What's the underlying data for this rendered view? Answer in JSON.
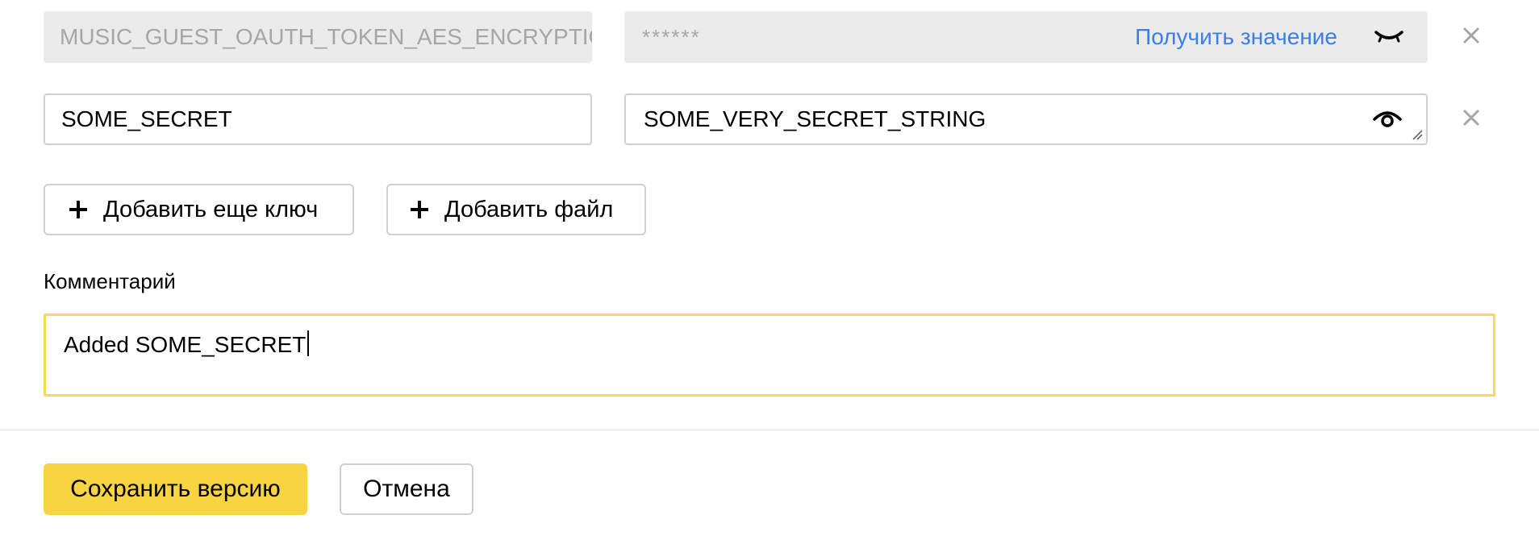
{
  "rows": [
    {
      "key": "MUSIC_GUEST_OAUTH_TOKEN_AES_ENCRYPTION",
      "value_masked": "******",
      "get_value_link": "Получить значение",
      "eye_icon": "eye-closed-icon",
      "remove_icon": "close-icon",
      "disabled": true
    },
    {
      "key": "SOME_SECRET",
      "value": "SOME_VERY_SECRET_STRING",
      "eye_icon": "eye-open-icon",
      "remove_icon": "close-icon",
      "disabled": false
    }
  ],
  "actions": {
    "add_key_label": "Добавить еще ключ",
    "add_file_label": "Добавить файл"
  },
  "comment": {
    "label": "Комментарий",
    "value": "Added SOME_SECRET"
  },
  "footer": {
    "save_label": "Сохранить версию",
    "cancel_label": "Отмена"
  },
  "colors": {
    "accent_yellow": "#f8d443",
    "focus_border": "#f8d95a",
    "link_blue": "#3a7ee8",
    "disabled_bg": "#ebebeb",
    "disabled_text": "#a6a6a6",
    "border_gray": "#cfcfcf"
  }
}
